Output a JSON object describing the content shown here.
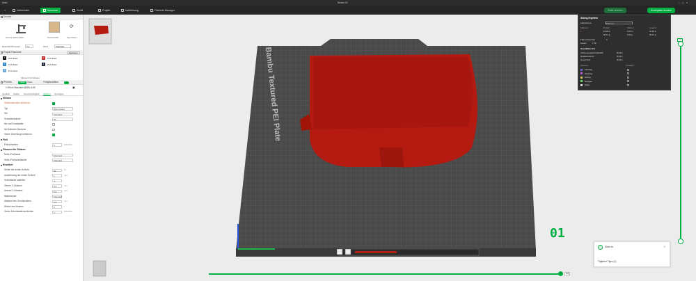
{
  "titlebar": {
    "menu": "Datei",
    "project_name": "Bambu 02"
  },
  "tabs": [
    "Vorbereiten",
    "Vorschau",
    "Gerät",
    "Projekt",
    "Kalibrierung",
    "Filament Manager"
  ],
  "actions": {
    "print_plate": "Platte drucken",
    "print_all": "Druckplatte drucken"
  },
  "left": {
    "printer_section": "Drucker",
    "printer_name": "Generic E3D-A1 Mini",
    "plate_label": "Textured PEI",
    "sync_label": "Sync Daten",
    "nozzle_label": "Düsendurchmesser",
    "nozzle_value": "0.4",
    "flow_label": "Fluss",
    "flow_value": "Standard",
    "filament_section": "Projekt Filamente",
    "filament_btn": "Bearbeiten",
    "filaments": [
      {
        "num": "1",
        "color": "#111111",
        "name": "PLA Basic"
      },
      {
        "num": "2",
        "color": "#c9302c",
        "name": "PLA Basic"
      },
      {
        "num": "3",
        "color": "#2f86c5",
        "name": "PLA Basic"
      },
      {
        "num": "4",
        "color": "#1f2a3a",
        "name": "PLA Basic"
      },
      {
        "num": "5",
        "color": "#6aa8d8",
        "name": "PLA Glow"
      }
    ],
    "add_filament": "Filament hinzufügen",
    "process_section": "Prozess",
    "process_global": "Global",
    "process_object": "Objekt",
    "process_advanced": "Fortgeschritten",
    "process_preset": "0.20mm Standard @BBL A1M",
    "process_tabs": [
      "Qualität",
      "Stärke",
      "Geschwindigkeit",
      "Stützen",
      "Sonstiges"
    ],
    "support_group": "Stützen",
    "support_rows": [
      {
        "label": "Stützmaterialien aktivieren",
        "type": "chk",
        "value": "on"
      },
      {
        "label": "Typ",
        "type": "val",
        "value": "Baum(Auto)"
      },
      {
        "label": "Stil",
        "type": "val",
        "value": "Standard"
      },
      {
        "label": "Schwellenwinkel",
        "type": "val",
        "value": "30"
      },
      {
        "label": "Nur auf Druckplatte",
        "type": "chk",
        "value": "off"
      },
      {
        "label": "Nur kritische Bereiche",
        "type": "chk",
        "value": "off"
      },
      {
        "label": "Kleine Überhänge entfernen",
        "type": "chk",
        "value": "on"
      }
    ],
    "raft_group": "Floß",
    "raft_rows": [
      {
        "label": "Floßschichten",
        "value": "0",
        "unit": "Schichten"
      }
    ],
    "filament_support_group": "Filament für Stützen",
    "filament_support_rows": [
      {
        "label": "Stütz-/Floßbasis",
        "value": "Standard"
      },
      {
        "label": "Stütz-/Floßschnittstelle",
        "value": "Standard"
      }
    ],
    "advanced_group": "Erweitert",
    "advanced_rows": [
      {
        "label": "Dichte der ersten Schicht",
        "value": "90",
        "unit": "%"
      },
      {
        "label": "Ausdehnung der ersten Schicht",
        "value": "1",
        "unit": "mm"
      },
      {
        "label": "Schnittstelle aufteilen",
        "value": "-1",
        "unit": ""
      },
      {
        "label": "Oberer Z-Abstand",
        "value": "0.2",
        "unit": "mm"
      },
      {
        "label": "Unterer Z-Abstand",
        "value": "0.2",
        "unit": "mm"
      },
      {
        "label": "Basismuster",
        "value": "Standard",
        "unit": ""
      },
      {
        "label": "Abstand des Grundmusters",
        "value": "2.5",
        "unit": "mm"
      },
      {
        "label": "Winkel des Musters",
        "value": "0",
        "unit": "°"
      },
      {
        "label": "Obere Schnittstellenschichten",
        "value": "2",
        "unit": "Schichten"
      }
    ]
  },
  "plate": {
    "label": "Bambu Textured PEI Plate",
    "layer_number": "01"
  },
  "slice_info": {
    "title": "Slicing-Ergebnis",
    "color_scheme_label": "Farbschema",
    "color_scheme_value": "Filament",
    "headers": [
      "Filament",
      "Modell",
      "Stützen",
      "Gesamt"
    ],
    "rows": [
      {
        "fil": "1",
        "model": "19.49 m",
        "support": "0.00 m",
        "total": "19.49 m"
      },
      {
        "fil": "",
        "model": "58.13 g",
        "support": "0.00 g",
        "total": "58.13 g"
      }
    ],
    "change_label": "Filamentwechsel",
    "change_value": "0",
    "cost_label": "Kosten",
    "cost_value": "1.39",
    "time_title": "Geschätzte Zeit",
    "time_rows": [
      {
        "label": "Vorbereitungszeit (Modell)",
        "value": "2h44m"
      },
      {
        "label": "Modelldruckzeit",
        "value": "2h44m"
      },
      {
        "label": "Gesamtzeit",
        "value": "2h44m"
      }
    ],
    "options_headers": [
      "Optionen",
      "Anzeigen"
    ],
    "options": [
      {
        "label": "Fahrweg",
        "color": "#6d6dd0"
      },
      {
        "label": "Rückzug",
        "color": "#c06ad8"
      },
      {
        "label": "Entzug",
        "color": "#d8c76a"
      },
      {
        "label": "Reinigen",
        "color": "#6ad86d"
      },
      {
        "label": "Nahte",
        "color": "#d8d8d8"
      }
    ]
  },
  "toast": {
    "title": "Slice ok.",
    "body": "Täglicher Tipps (1)"
  },
  "sliders": {
    "top_value": "120",
    "bottom_value": "1",
    "horizontal_end": "116"
  }
}
